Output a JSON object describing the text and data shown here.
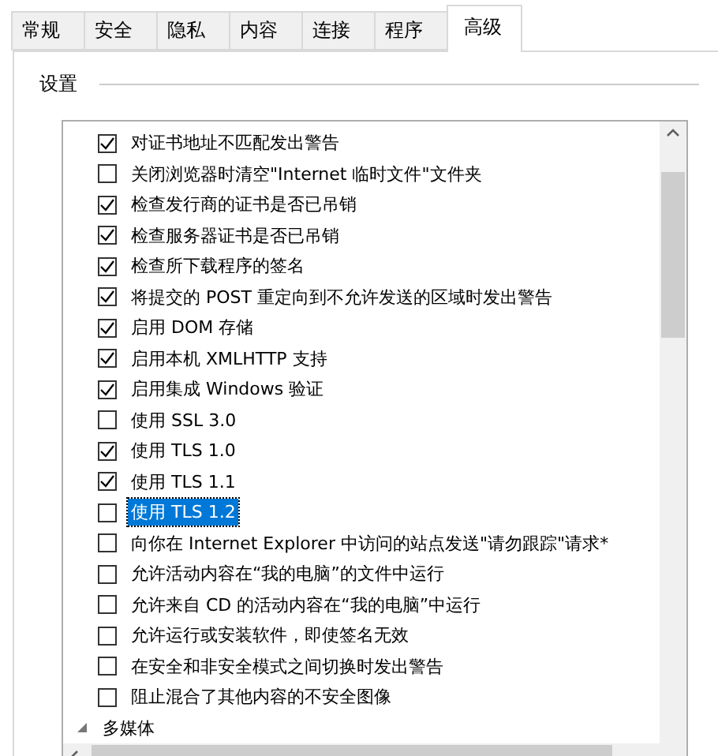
{
  "tabs": [
    {
      "label": "常规",
      "selected": false
    },
    {
      "label": "安全",
      "selected": false
    },
    {
      "label": "隐私",
      "selected": false
    },
    {
      "label": "内容",
      "selected": false
    },
    {
      "label": "连接",
      "selected": false
    },
    {
      "label": "程序",
      "selected": false
    },
    {
      "label": "高级",
      "selected": true
    }
  ],
  "group": {
    "title": "设置"
  },
  "settings": [
    {
      "kind": "checkbox",
      "label": "对证书地址不匹配发出警告",
      "checked": true,
      "selected": false
    },
    {
      "kind": "checkbox",
      "label": "关闭浏览器时清空\"Internet 临时文件\"文件夹",
      "checked": false,
      "selected": false
    },
    {
      "kind": "checkbox",
      "label": "检查发行商的证书是否已吊销",
      "checked": true,
      "selected": false
    },
    {
      "kind": "checkbox",
      "label": "检查服务器证书是否已吊销",
      "checked": true,
      "selected": false
    },
    {
      "kind": "checkbox",
      "label": "检查所下载程序的签名",
      "checked": true,
      "selected": false
    },
    {
      "kind": "checkbox",
      "label": "将提交的 POST 重定向到不允许发送的区域时发出警告",
      "checked": true,
      "selected": false
    },
    {
      "kind": "checkbox",
      "label": "启用 DOM 存储",
      "checked": true,
      "selected": false
    },
    {
      "kind": "checkbox",
      "label": "启用本机 XMLHTTP 支持",
      "checked": true,
      "selected": false
    },
    {
      "kind": "checkbox",
      "label": "启用集成 Windows 验证",
      "checked": true,
      "selected": false
    },
    {
      "kind": "checkbox",
      "label": "使用 SSL 3.0",
      "checked": false,
      "selected": false
    },
    {
      "kind": "checkbox",
      "label": "使用 TLS 1.0",
      "checked": true,
      "selected": false
    },
    {
      "kind": "checkbox",
      "label": "使用 TLS 1.1",
      "checked": true,
      "selected": false
    },
    {
      "kind": "checkbox",
      "label": "使用 TLS 1.2",
      "checked": false,
      "selected": true
    },
    {
      "kind": "checkbox",
      "label": "向你在 Internet Explorer 中访问的站点发送\"请勿跟踪\"请求*",
      "checked": false,
      "selected": false
    },
    {
      "kind": "checkbox",
      "label": "允许活动内容在“我的电脑”的文件中运行",
      "checked": false,
      "selected": false
    },
    {
      "kind": "checkbox",
      "label": "允许来自 CD 的活动内容在“我的电脑”中运行",
      "checked": false,
      "selected": false
    },
    {
      "kind": "checkbox",
      "label": "允许运行或安装软件，即使签名无效",
      "checked": false,
      "selected": false
    },
    {
      "kind": "checkbox",
      "label": "在安全和非安全模式之间切换时发出警告",
      "checked": false,
      "selected": false
    },
    {
      "kind": "checkbox",
      "label": "阻止混合了其他内容的不安全图像",
      "checked": false,
      "selected": false
    },
    {
      "kind": "category",
      "label": "多媒体",
      "selected": false
    }
  ]
}
